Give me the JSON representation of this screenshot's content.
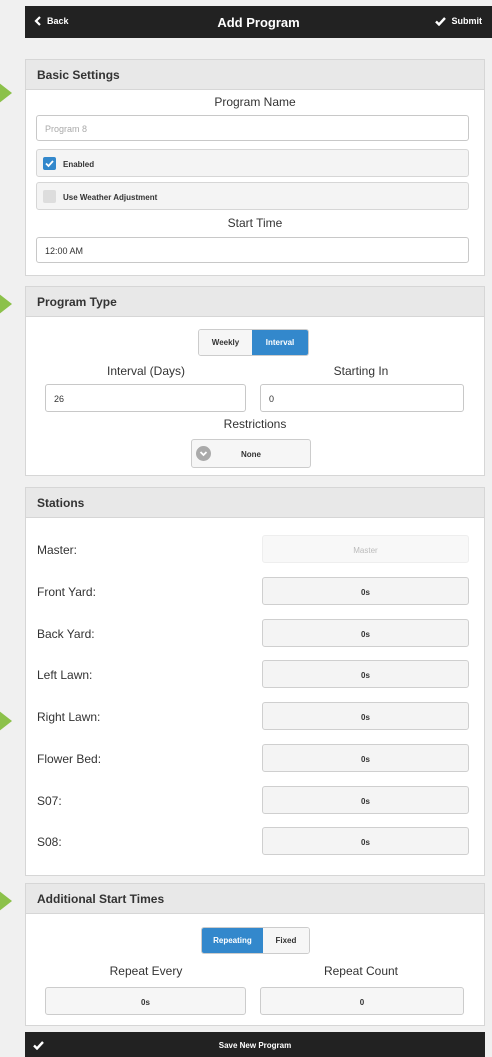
{
  "header": {
    "back": "Back",
    "title": "Add Program",
    "submit": "Submit"
  },
  "basic": {
    "heading": "Basic Settings",
    "program_name_label": "Program Name",
    "program_name_placeholder": "Program 8",
    "enabled_label": "Enabled",
    "enabled_checked": true,
    "weather_label": "Use Weather Adjustment",
    "weather_checked": false,
    "start_time_label": "Start Time",
    "start_time_value": "12:00 AM"
  },
  "program_type": {
    "heading": "Program Type",
    "options": [
      "Weekly",
      "Interval"
    ],
    "selected": "Interval",
    "interval_label": "Interval (Days)",
    "interval_value": "26",
    "starting_label": "Starting In",
    "starting_value": "0",
    "restrictions_label": "Restrictions",
    "restrictions_value": "None"
  },
  "stations": {
    "heading": "Stations",
    "items": [
      {
        "name": "Master:",
        "value": "Master"
      },
      {
        "name": "Front Yard:",
        "value": "0s"
      },
      {
        "name": "Back Yard:",
        "value": "0s"
      },
      {
        "name": "Left Lawn:",
        "value": "0s"
      },
      {
        "name": "Right Lawn:",
        "value": "0s"
      },
      {
        "name": "Flower Bed:",
        "value": "0s"
      },
      {
        "name": "S07:",
        "value": "0s"
      },
      {
        "name": "S08:",
        "value": "0s"
      }
    ]
  },
  "additional": {
    "heading": "Additional Start Times",
    "options": [
      "Repeating",
      "Fixed"
    ],
    "selected": "Repeating",
    "repeat_every_label": "Repeat Every",
    "repeat_every_value": "0s",
    "repeat_count_label": "Repeat Count",
    "repeat_count_value": "0"
  },
  "footer": {
    "save_label": "Save New Program"
  },
  "colors": {
    "accent": "#3388cc",
    "arrow": "#8cc14a",
    "bar": "#222222"
  }
}
